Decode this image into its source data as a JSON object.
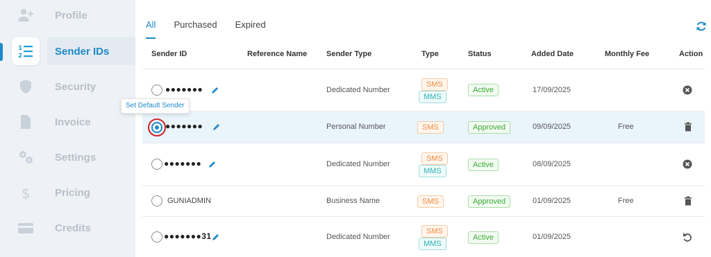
{
  "sidebar": {
    "items": [
      {
        "label": "Profile",
        "icon": "user-add-icon"
      },
      {
        "label": "Sender IDs",
        "icon": "numbered-list-icon",
        "active": true
      },
      {
        "label": "Security",
        "icon": "shield-icon"
      },
      {
        "label": "Invoice",
        "icon": "document-icon"
      },
      {
        "label": "Settings",
        "icon": "gears-icon"
      },
      {
        "label": "Pricing",
        "icon": "dollar-icon"
      },
      {
        "label": "Credits",
        "icon": "card-icon"
      }
    ]
  },
  "tabs": [
    {
      "label": "All",
      "active": true
    },
    {
      "label": "Purchased"
    },
    {
      "label": "Expired"
    }
  ],
  "columns": {
    "sender_id": "Sender ID",
    "reference_name": "Reference Name",
    "sender_type": "Sender Type",
    "type": "Type",
    "status": "Status",
    "added_date": "Added Date",
    "monthly_fee": "Monthly Fee",
    "action": "Action"
  },
  "tooltip": "Set Default Sender",
  "rows": [
    {
      "sender_id": "●●●●●●●",
      "sender_type": "Dedicated Number",
      "types": [
        "SMS",
        "MMS"
      ],
      "status": "Active",
      "added_date": "17/09/2025",
      "monthly_fee": "",
      "action": "remove-icon"
    },
    {
      "sender_id": "●●●●●●●",
      "sender_type": "Personal Number",
      "types": [
        "SMS"
      ],
      "status": "Approved",
      "added_date": "09/09/2025",
      "monthly_fee": "Free",
      "action": "trash-icon"
    },
    {
      "sender_id": "●●●●●●●",
      "sender_type": "Dedicated Number",
      "types": [
        "SMS",
        "MMS"
      ],
      "status": "Active",
      "added_date": "08/09/2025",
      "monthly_fee": "",
      "action": "remove-icon"
    },
    {
      "sender_id": "GUNIADMIN",
      "sender_type": "Business Name",
      "types": [
        "SMS"
      ],
      "status": "Approved",
      "added_date": "01/09/2025",
      "monthly_fee": "Free",
      "action": "trash-icon"
    },
    {
      "sender_id": "●●●●●●●31",
      "sender_type": "Dedicated Number",
      "types": [
        "SMS",
        "MMS"
      ],
      "status": "Active",
      "added_date": "01/09/2025",
      "monthly_fee": "",
      "action": "undo-icon"
    }
  ],
  "colors": {
    "accent": "#1e88c8",
    "sms": "#f08a3c",
    "mms": "#2cb4b4",
    "status_green": "#3aaa35"
  }
}
